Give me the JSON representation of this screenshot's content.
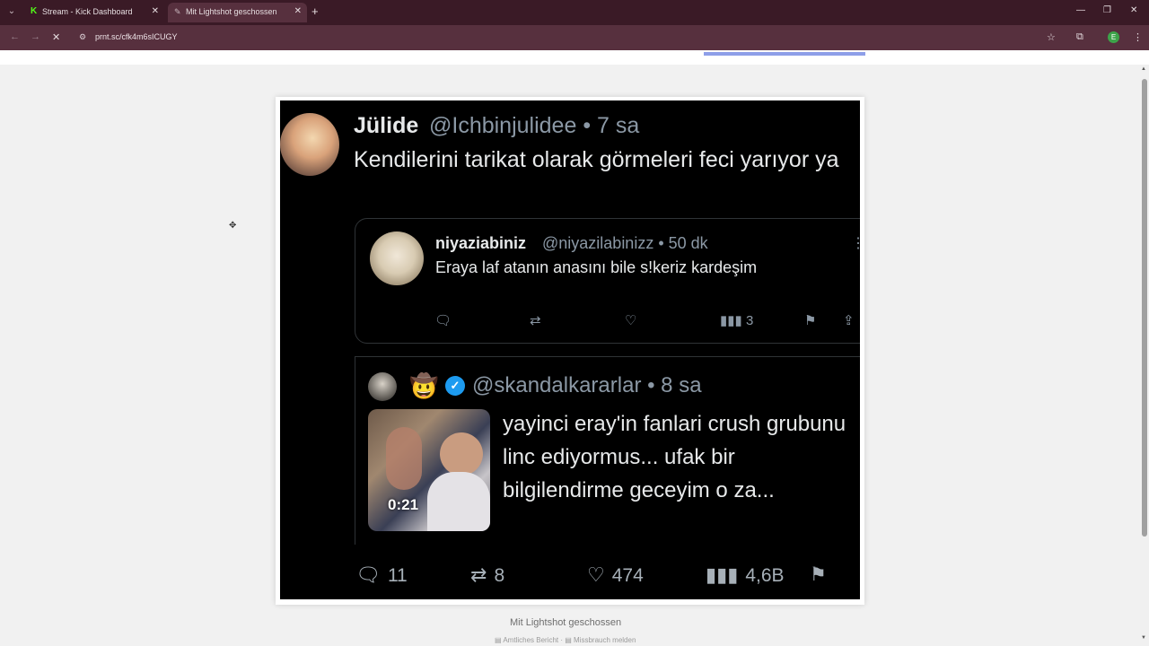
{
  "browser": {
    "tabs": [
      {
        "label": "Stream - Kick Dashboard",
        "favicon": "kick-icon"
      },
      {
        "label": "Mit Lightshot geschossen",
        "favicon": "lightshot-icon"
      }
    ],
    "url": "prnt.sc/cfk4m6sICUGY",
    "profile_initial": "E"
  },
  "tweet": {
    "author_name": "Jülide",
    "author_handle": "@Ichbinjulidee • 7 sa",
    "text": "Kendilerini tarikat olarak görmeleri feci yarıyor ya",
    "quote1": {
      "name": "niyaziabiniz",
      "handle": "@niyazilabinizz • 50 dk",
      "text": "Eraya laf atanın anasını bile s!keriz kardeşim",
      "views": "3"
    },
    "quote2": {
      "handle": "@skandalkararlar • 8 sa",
      "video_duration": "0:21",
      "text": "yayinci eray'in fanlari crush grubunu linc ediyormus... ufak bir bilgilendirme geceyim o za..."
    },
    "stats": {
      "replies": "11",
      "retweets": "8",
      "likes": "474",
      "views": "4,6B"
    }
  },
  "page": {
    "caption": "Mit Lightshot geschossen",
    "footer": "▤ Amtliches Bericht · ▤ Missbrauch melden"
  }
}
